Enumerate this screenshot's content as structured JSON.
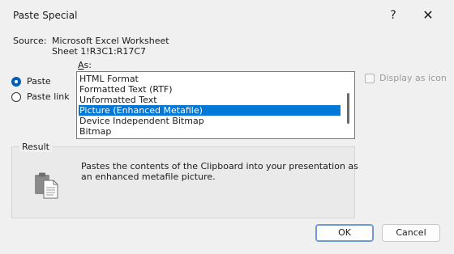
{
  "window": {
    "title": "Paste Special",
    "help_glyph": "?",
    "close_glyph": "✕"
  },
  "source": {
    "label": "Source:",
    "line1": "Microsoft Excel Worksheet",
    "line2": "Sheet 1!R3C1:R17C7"
  },
  "as": {
    "label_accel": "A",
    "label_rest": "s:"
  },
  "options": {
    "paste": {
      "label": "Paste",
      "checked": true
    },
    "paste_link": {
      "label": "Paste link",
      "checked": false
    }
  },
  "formats": {
    "items": [
      "HTML Format",
      "Formatted Text (RTF)",
      "Unformatted Text",
      "Picture (Enhanced Metafile)",
      "Device Independent Bitmap",
      "Bitmap"
    ],
    "selected": "Picture (Enhanced Metafile)"
  },
  "display_as_icon": {
    "label": "Display as icon",
    "checked": false,
    "enabled": false
  },
  "result": {
    "legend": "Result",
    "line1": "Pastes the contents of the Clipboard into your presentation as",
    "line2": "an enhanced metafile picture."
  },
  "buttons": {
    "ok": "OK",
    "cancel": "Cancel"
  },
  "colors": {
    "selection": "#0078d7",
    "radio_checked": "#005fb8"
  }
}
